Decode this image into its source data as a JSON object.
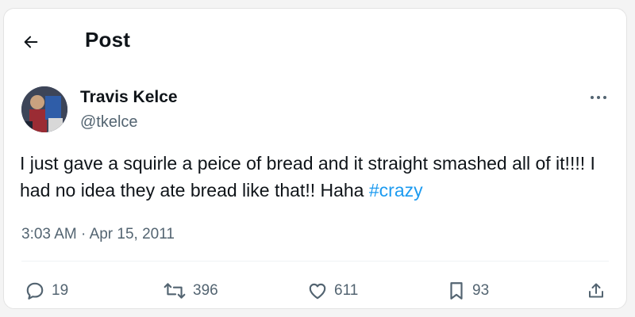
{
  "header": {
    "title": "Post",
    "back_icon": "arrow-left-icon"
  },
  "author": {
    "name": "Travis Kelce",
    "handle": "@tkelce",
    "avatar_icon": "profile-photo"
  },
  "post": {
    "text": "I just gave a squirle a peice of bread and it straight smashed all of it!!!! I had no idea they ate bread like that!! Haha ",
    "hashtag": "#crazy",
    "hashtag_color": "#1d9bf0",
    "time": "3:03 AM",
    "separator": " · ",
    "date": "Apr 15, 2011"
  },
  "actions": {
    "replies": "19",
    "reposts": "396",
    "likes": "611",
    "bookmarks": "93",
    "icons": [
      "reply-icon",
      "repost-icon",
      "like-icon",
      "bookmark-icon",
      "share-icon"
    ]
  },
  "colors": {
    "text": "#0f1419",
    "secondary": "#536471",
    "accent": "#1d9bf0"
  }
}
